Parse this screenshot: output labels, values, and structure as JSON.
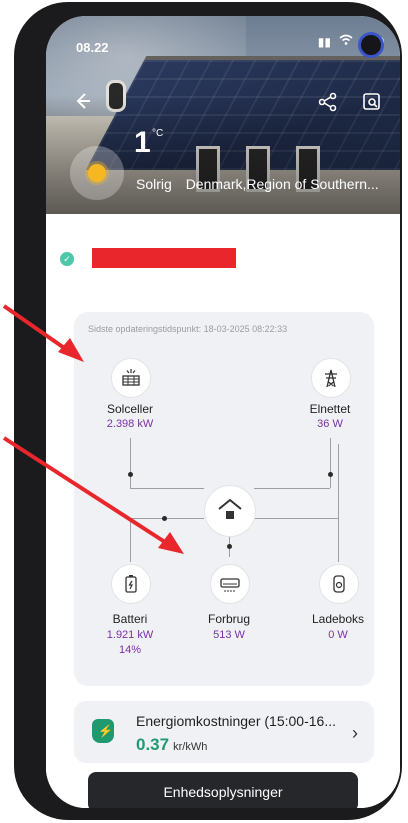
{
  "status_bar": {
    "time": "08.22",
    "battery": "100"
  },
  "weather": {
    "temperature": "1",
    "unit": "°C",
    "condition": "Solrig",
    "location": "Denmark,Region of Southern..."
  },
  "flow": {
    "last_updated": "Sidste opdateringstidspunkt: 18-03-2025 08:22:33",
    "solar": {
      "label": "Solceller",
      "value": "2.398 kW"
    },
    "grid": {
      "label": "Elnettet",
      "value": "36 W"
    },
    "battery": {
      "label": "Batteri",
      "value": "1.921 kW",
      "soc": "14%"
    },
    "consumption": {
      "label": "Forbrug",
      "value": "513 W"
    },
    "charger": {
      "label": "Ladeboks",
      "value": "0 W"
    }
  },
  "energy_cost": {
    "title": "Energiomkostninger (15:00-16...",
    "value": "0.37",
    "unit": "kr/kWh"
  },
  "device_button": "Enhedsoplysninger",
  "colors": {
    "accent_value": "#7b2fa8",
    "cost_green": "#1f9a6f",
    "annotation_red": "#e8262b"
  }
}
